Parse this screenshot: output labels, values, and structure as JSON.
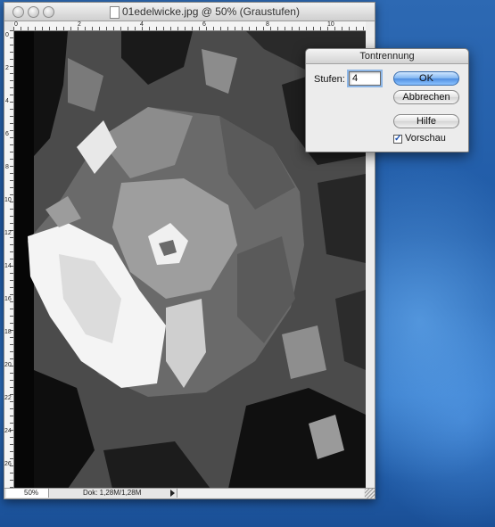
{
  "window": {
    "title": "01edelwicke.jpg @ 50% (Graustufen)",
    "zoom": "50%",
    "doc_info": "Dok: 1,28M/1,28M"
  },
  "rulers": {
    "top": [
      "0",
      "2",
      "4",
      "6",
      "8",
      "10"
    ],
    "left": [
      "0",
      "2",
      "4",
      "6",
      "8",
      "10",
      "12",
      "14",
      "16",
      "18",
      "20",
      "22",
      "24",
      "26"
    ]
  },
  "dialog": {
    "title": "Tontrennung",
    "stufen_label": "Stufen:",
    "stufen_value": "4",
    "ok_label": "OK",
    "cancel_label": "Abbrechen",
    "help_label": "Hilfe",
    "preview_label": "Vorschau",
    "preview_checked": true
  },
  "icons": {
    "close": "close-icon",
    "minimize": "minimize-icon",
    "zoom": "zoom-icon",
    "document": "document-icon",
    "status_menu": "chevron-right-icon",
    "checkmark": "checkmark-icon"
  }
}
